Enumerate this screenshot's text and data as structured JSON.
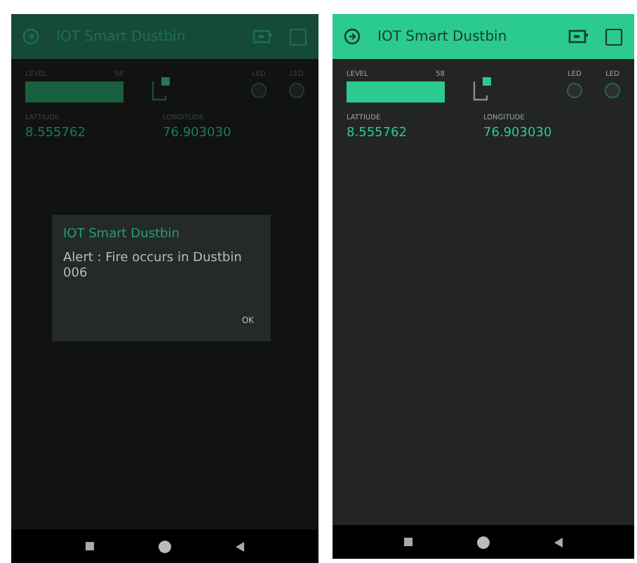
{
  "phones": [
    {
      "dimmed": true,
      "header": {
        "title": "IOT Smart Dustbin"
      },
      "level": {
        "label": "LEVEL",
        "reading": "58",
        "level": 1
      },
      "leds": [
        {
          "label": "LED",
          "on": false
        },
        {
          "label": "LED",
          "on": false
        }
      ],
      "values": [
        {
          "label": "LATTIUDE",
          "value": "8.555762"
        },
        {
          "label": "LONGITUDE",
          "value": "76.903030"
        }
      ],
      "dialog": {
        "title": "IOT Smart Dustbin",
        "message": "Alert : Fire occurs in Dustbin 006",
        "button": "OK"
      }
    },
    {
      "dimmed": false,
      "header": {
        "title": "IOT Smart Dustbin"
      },
      "level": {
        "label": "LEVEL",
        "reading": "58",
        "level": 1
      },
      "leds": [
        {
          "label": "LED",
          "on": false
        },
        {
          "label": "LED",
          "on": false
        }
      ],
      "values": [
        {
          "label": "LATTIUDE",
          "value": "8.555762"
        },
        {
          "label": "LONGITUDE",
          "value": "76.903030"
        }
      ]
    }
  ]
}
